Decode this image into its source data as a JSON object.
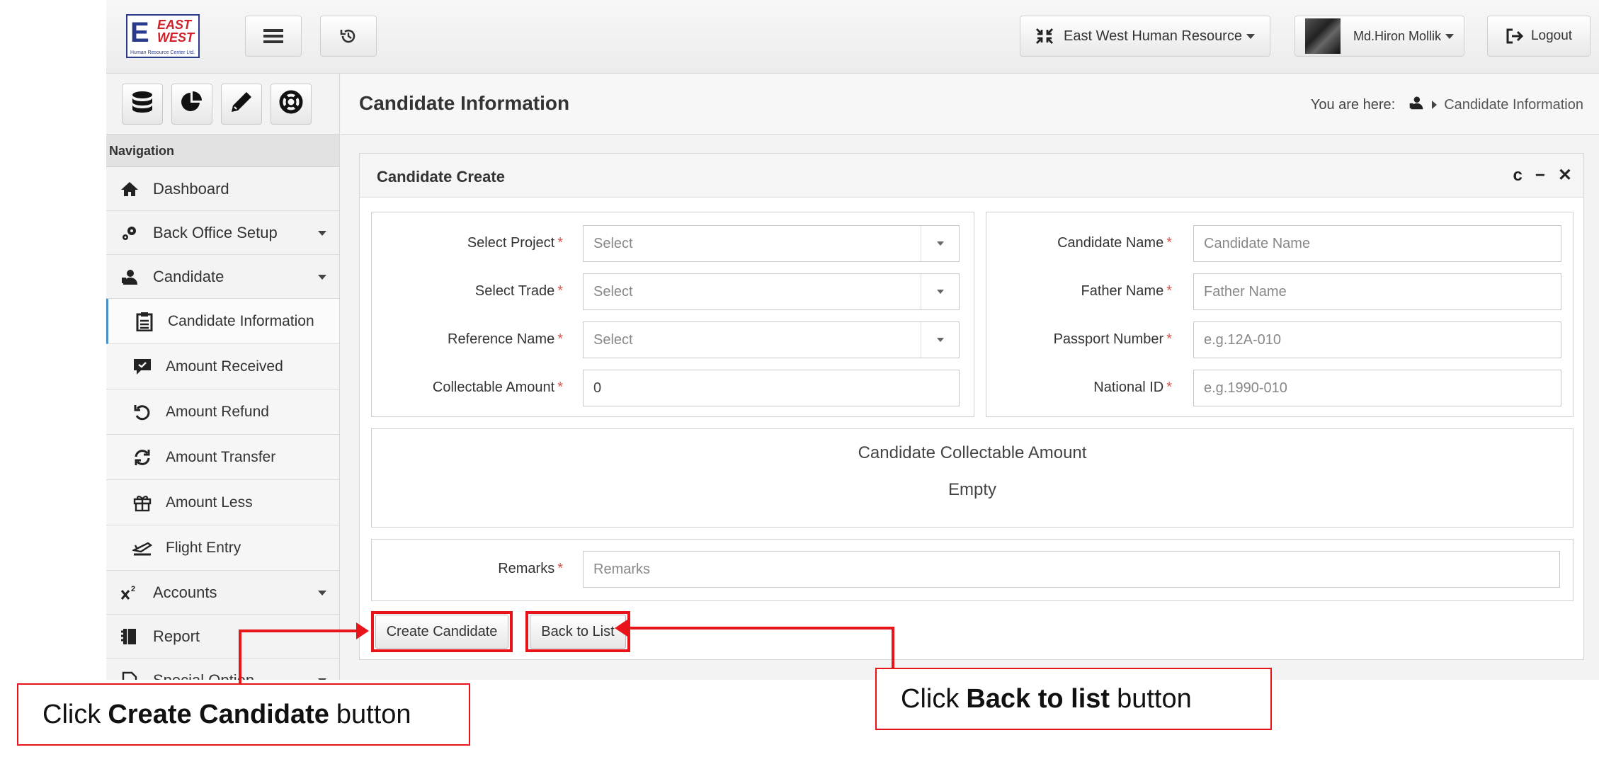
{
  "topbar": {
    "logo_main": "E",
    "logo_east": "EAST",
    "logo_west": "WEST",
    "logo_sub": "Human Resource Center Ltd.",
    "menu_icon": "hamburger-icon",
    "history_icon": "history-icon",
    "company_label": "East West Human Resource",
    "user_label": "Md.Hiron Mollik",
    "logout_label": "Logout"
  },
  "sidebar": {
    "tool_icons": [
      "database-icon",
      "pie-chart-icon",
      "pencil-icon",
      "life-ring-icon"
    ],
    "nav_header": "Navigation",
    "items": [
      {
        "label": "Dashboard",
        "icon": "home-icon"
      },
      {
        "label": "Back Office Setup",
        "icon": "gears-icon"
      },
      {
        "label": "Candidate",
        "icon": "user-icon"
      }
    ],
    "sub_items": [
      {
        "label": "Candidate Information",
        "icon": "clipboard-icon"
      },
      {
        "label": "Amount Received",
        "icon": "comment-icon"
      },
      {
        "label": "Amount Refund",
        "icon": "undo-icon"
      },
      {
        "label": "Amount Transfer",
        "icon": "refresh-icon"
      },
      {
        "label": "Amount Less",
        "icon": "gift-icon"
      },
      {
        "label": "Flight Entry",
        "icon": "flight-icon"
      }
    ],
    "items_after": [
      {
        "label": "Accounts",
        "icon": "superscript-icon"
      },
      {
        "label": "Report",
        "icon": "book-icon"
      },
      {
        "label": "Special Option",
        "icon": "file-icon"
      }
    ]
  },
  "page": {
    "title": "Candidate Information",
    "breadcrumb_prefix": "You are here:",
    "breadcrumb_current": "Candidate Information"
  },
  "panel": {
    "title": "Candidate Create",
    "tools": [
      "c",
      "−",
      "✕"
    ]
  },
  "form": {
    "left": [
      {
        "label": "Select Project",
        "placeholder": "Select",
        "type": "select"
      },
      {
        "label": "Select Trade",
        "placeholder": "Select",
        "type": "select"
      },
      {
        "label": "Reference Name",
        "placeholder": "Select",
        "type": "select"
      },
      {
        "label": "Collectable Amount",
        "value": "0",
        "type": "input"
      }
    ],
    "right": [
      {
        "label": "Candidate Name",
        "placeholder": "Candidate Name"
      },
      {
        "label": "Father Name",
        "placeholder": "Father Name"
      },
      {
        "label": "Passport Number",
        "placeholder": "e.g.12A-010"
      },
      {
        "label": "National ID",
        "placeholder": "e.g.1990-010"
      }
    ],
    "required_mark": "*",
    "summary_title": "Candidate Collectable Amount",
    "summary_value": "Empty",
    "remarks_label": "Remarks",
    "remarks_placeholder": "Remarks",
    "create_button": "Create Candidate",
    "back_button": "Back to List"
  },
  "annotations": {
    "left_prefix": "Click",
    "left_bold": "Create Candidate",
    "left_suffix": "button",
    "right_prefix": "Click",
    "right_bold": "Back to list",
    "right_suffix": "button",
    "accent": "#e8141a"
  }
}
